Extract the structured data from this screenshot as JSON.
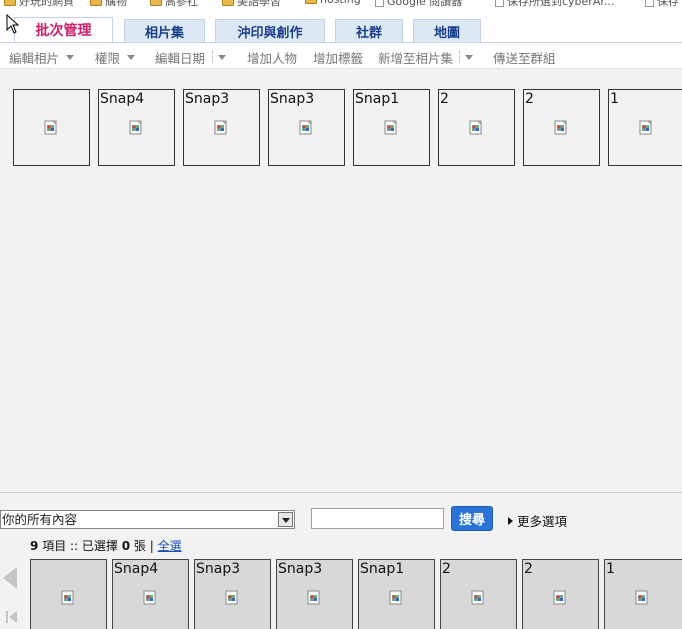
{
  "bookmarks": [
    {
      "label": "好玩的網頁",
      "icon": "folder-icon"
    },
    {
      "label": "購物",
      "icon": "folder-icon"
    },
    {
      "label": "高參社",
      "icon": "folder-icon"
    },
    {
      "label": "美語學習",
      "icon": "folder-icon"
    },
    {
      "label": "hosting",
      "icon": "folder-icon"
    },
    {
      "label": "Google 閱讀器",
      "icon": "google-icon"
    },
    {
      "label": "保存所選到cyberAr...",
      "icon": "page-icon"
    },
    {
      "label": "保存",
      "icon": "page-icon"
    }
  ],
  "tabs": [
    {
      "label": "批次管理",
      "active": true
    },
    {
      "label": "相片集",
      "active": false
    },
    {
      "label": "沖印與創作",
      "active": false
    },
    {
      "label": "社群",
      "active": false
    },
    {
      "label": "地圖",
      "active": false
    }
  ],
  "toolbar": {
    "edit_photos": "編輯相片",
    "permissions": "權限",
    "edit_date": "編輯日期",
    "add_people": "增加人物",
    "add_tags": "增加標籤",
    "add_to_album": "新增至相片集",
    "send_to_group": "傳送至群組"
  },
  "grid": {
    "items": [
      {
        "caption": ""
      },
      {
        "caption": "Snap4"
      },
      {
        "caption": "Snap3"
      },
      {
        "caption": "Snap3"
      },
      {
        "caption": "Snap1"
      },
      {
        "caption": "2"
      },
      {
        "caption": "2"
      },
      {
        "caption": "1"
      }
    ]
  },
  "bottom": {
    "scope_selected": "你的所有內容",
    "search_value": "",
    "search_button": "搜尋",
    "more_options": "更多選項",
    "status": {
      "count": "9",
      "items_text": "項目 :: 已選擇",
      "selected": "0",
      "selected_unit": "張 |",
      "select_all": "全選"
    }
  },
  "filmstrip": {
    "items": [
      {
        "caption": ""
      },
      {
        "caption": "Snap4"
      },
      {
        "caption": "Snap3"
      },
      {
        "caption": "Snap3"
      },
      {
        "caption": "Snap1"
      },
      {
        "caption": "2"
      },
      {
        "caption": "2"
      },
      {
        "caption": "1"
      }
    ]
  },
  "colors": {
    "active_tab_text": "#d0206a",
    "tab_text": "#1a3f8a",
    "search_button": "#2a72d6",
    "link": "#1a4fb0"
  }
}
